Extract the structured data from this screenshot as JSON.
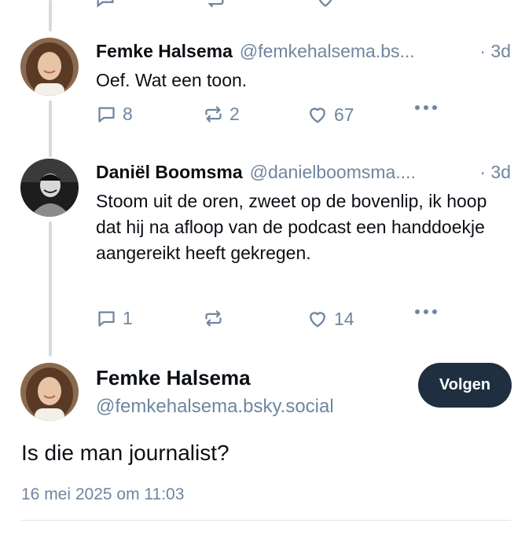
{
  "colors": {
    "text_primary": "#0b0f14",
    "text_secondary": "#6f869f",
    "thread_line": "#d4dbe2",
    "follow_button_bg": "#1f2f3f",
    "follow_button_text": "#ffffff"
  },
  "replies": [
    {
      "author_name": "Femke Halsema",
      "handle": "@femkehalsema.bs...",
      "time": "· 3d",
      "text": "Oef. Wat een toon.",
      "reply_count": "8",
      "repost_count": "2",
      "like_count": "67",
      "avatar": "woman-with-curly-hair-photo"
    },
    {
      "author_name": "Daniël Boomsma",
      "handle": "@danielboomsma....",
      "time": "· 3d",
      "text": "Stoom uit de oren, zweet op de bovenlip, ik hoop dat hij na afloop van de podcast een handdoekje aangereikt heeft gekregen.",
      "reply_count": "1",
      "repost_count": "",
      "like_count": "14",
      "avatar": "black-and-white-man-photo"
    }
  ],
  "main_post": {
    "author_name": "Femke Halsema",
    "handle": "@femkehalsema.bsky.social",
    "follow_label": "Volgen",
    "text": "Is die man journalist?",
    "date": "16 mei 2025 om 11:03",
    "avatar": "woman-with-curly-hair-photo"
  },
  "icons": {
    "reply": "speech-bubble-icon",
    "repost": "repost-arrows-icon",
    "like": "heart-icon",
    "more": "more-dots-icon"
  }
}
